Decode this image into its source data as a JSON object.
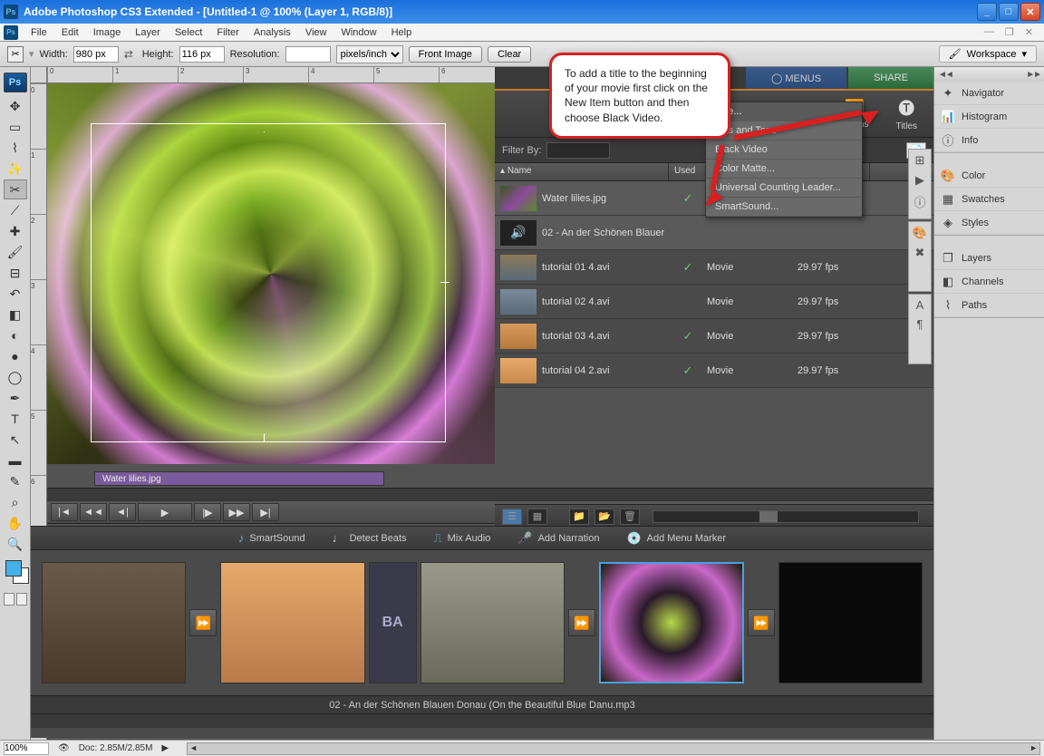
{
  "titlebar": {
    "title": "Adobe Photoshop CS3 Extended - [Untitled-1 @ 100% (Layer 1, RGB/8)]"
  },
  "menu": {
    "items": [
      "File",
      "Edit",
      "Image",
      "Layer",
      "Select",
      "Filter",
      "Analysis",
      "View",
      "Window",
      "Help"
    ]
  },
  "options": {
    "width_label": "Width:",
    "width_value": "980 px",
    "height_label": "Height:",
    "height_value": "116 px",
    "res_label": "Resolution:",
    "res_value": "",
    "res_unit": "pixels/inch",
    "front_image": "Front Image",
    "clear": "Clear",
    "workspace": "Workspace"
  },
  "dock": {
    "items1": [
      "Navigator",
      "Histogram",
      "Info"
    ],
    "items2": [
      "Color",
      "Swatches",
      "Styles"
    ],
    "items3": [
      "Layers",
      "Channels",
      "Paths"
    ]
  },
  "media": {
    "panel_tool_1": "…tions",
    "panel_tool_2": "Titles",
    "filter_label": "Filter By:",
    "cols": {
      "name": "Name",
      "used": "Used"
    },
    "rows": [
      {
        "name": "Water lilies.jpg",
        "used": "✓",
        "type": "",
        "fps": ""
      },
      {
        "name": "02 - An der Schönen Blauer",
        "used": "",
        "type": "",
        "fps": ""
      },
      {
        "name": "tutorial 01 4.avi",
        "used": "✓",
        "type": "Movie",
        "fps": "29.97 fps"
      },
      {
        "name": "tutorial 02 4.avi",
        "used": "",
        "type": "Movie",
        "fps": "29.97 fps"
      },
      {
        "name": "tutorial 03 4.avi",
        "used": "✓",
        "type": "Movie",
        "fps": "29.97 fps"
      },
      {
        "name": "tutorial 04 2.avi",
        "used": "✓",
        "type": "Movie",
        "fps": "29.97 fps"
      }
    ]
  },
  "popup": {
    "items": [
      "Title...",
      "…rs and Tone",
      "Black Video",
      "Color Matte...",
      "Universal Counting Leader...",
      "SmartSound..."
    ]
  },
  "timeline": {
    "clip_label": "Water lilies.jpg"
  },
  "sb_tools": {
    "smartsound": "SmartSound",
    "detect": "Detect Beats",
    "mix": "Mix Audio",
    "narr": "Add Narration",
    "marker": "Add Menu Marker"
  },
  "sb_caption": "02 - An der Schönen Blauen Donau (On the Beautiful Blue Danu.mp3",
  "status": {
    "zoom": "100%",
    "doc": "Doc: 2.85M/2.85M"
  },
  "callout": "To add a title to the beginning of your movie first click on the New Item button and then choose Black Video."
}
